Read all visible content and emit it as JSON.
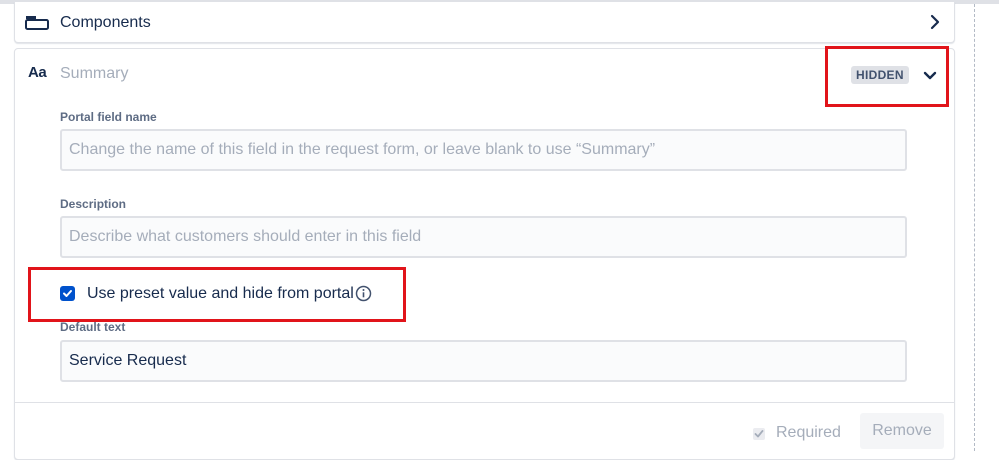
{
  "components_row": {
    "label": "Components",
    "icon": "component-icon",
    "expand_icon": "chevron-right-icon"
  },
  "summary_field": {
    "type_icon": "Aa",
    "title": "Summary",
    "status_badge": "HIDDEN",
    "collapse_icon": "chevron-down-icon"
  },
  "portal_field_name": {
    "label": "Portal field name",
    "value": "",
    "placeholder": "Change the name of this field in the request form, or leave blank to use “Summary”"
  },
  "description": {
    "label": "Description",
    "value": "",
    "placeholder": "Describe what customers should enter in this field"
  },
  "preset_option": {
    "label": "Use preset value and hide from portal",
    "checked": true,
    "info_icon": "info-icon"
  },
  "default_text": {
    "label": "Default text",
    "value": "Service Request"
  },
  "footer": {
    "required_label": "Required",
    "required_checked": true,
    "remove_label": "Remove"
  },
  "colors": {
    "highlight_box": "#e1141a",
    "checkbox_fill": "#0052cc",
    "badge_bg": "#dfe1e6",
    "text_primary": "#172b4d",
    "text_muted": "#a5adba"
  }
}
